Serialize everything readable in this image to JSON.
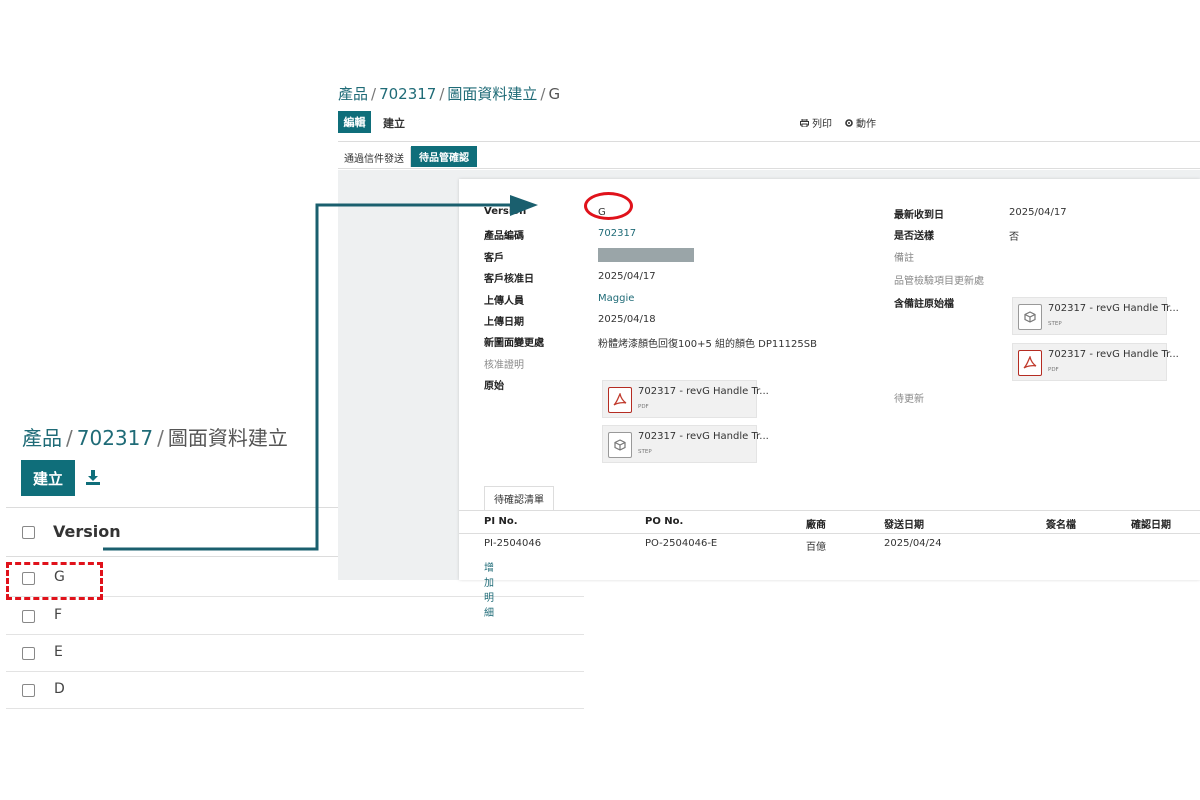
{
  "list_view": {
    "breadcrumb": [
      "產品",
      "702317",
      "圖面資料建立"
    ],
    "breadcrumb_sep": "/",
    "create_label": "建立",
    "download_icon": "download-icon",
    "column_header": "Version",
    "rows": [
      "G",
      "F",
      "E",
      "D"
    ]
  },
  "form_view": {
    "breadcrumb": [
      "產品",
      "702317",
      "圖面資料建立",
      "G"
    ],
    "breadcrumb_sep": "/",
    "toolbar": {
      "edit_label": "編輯",
      "create_label": "建立",
      "print_label": "列印",
      "print_icon": "print-icon",
      "action_label": "動作",
      "action_icon": "gear-icon"
    },
    "status_buttons": {
      "send_label": "通過信件發送",
      "qc_label": "待品管確認"
    },
    "left_fields": [
      {
        "label": "Version",
        "value": "G"
      },
      {
        "label": "產品編碼",
        "value": "702317"
      },
      {
        "label": "客戶",
        "value": ""
      },
      {
        "label": "客戶核准日",
        "value": "2025/04/17"
      },
      {
        "label": "上傳人員",
        "value": "Maggie"
      },
      {
        "label": "上傳日期",
        "value": "2025/04/18"
      },
      {
        "label": "新圖面變更處",
        "value": "粉體烤漆顏色回復100+5 組的顏色 DP11125SB"
      },
      {
        "label": "核准證明",
        "value": ""
      },
      {
        "label": "原始",
        "value": ""
      }
    ],
    "right_fields": [
      {
        "label": "最新收到日",
        "value": "2025/04/17"
      },
      {
        "label": "是否送樣",
        "value": "否"
      },
      {
        "label": "備註",
        "value": ""
      },
      {
        "label": "品管檢驗項目更新處",
        "value": ""
      },
      {
        "label": "含備註原始檔",
        "value": ""
      },
      {
        "label": "待更新",
        "value": ""
      }
    ],
    "original_attachments": [
      {
        "name": "702317 - revG Handle Tr...",
        "type": "PDF",
        "icon": "pdf-icon"
      },
      {
        "name": "702317 - revG Handle Tr...",
        "type": "STEP",
        "icon": "cube-icon"
      }
    ],
    "annotated_attachments": [
      {
        "name": "702317 - revG Handle Tr...",
        "type": "STEP",
        "icon": "cube-icon"
      },
      {
        "name": "702317 - revG Handle Tr...",
        "type": "PDF",
        "icon": "pdf-icon"
      }
    ],
    "tab_label": "待確認清單",
    "table": {
      "headers": [
        "PI No.",
        "PO No.",
        "廠商",
        "發送日期",
        "簽名檔",
        "確認日期"
      ],
      "rows": [
        [
          "PI-2504046",
          "PO-2504046-E",
          "百億",
          "2025/04/24",
          "",
          ""
        ]
      ],
      "add_line_label": "增加明細"
    }
  },
  "colors": {
    "primary": "#0f6e7a",
    "link": "#1f6b77",
    "annotation_red": "#e0121b",
    "arrow": "#1a5f6e"
  }
}
